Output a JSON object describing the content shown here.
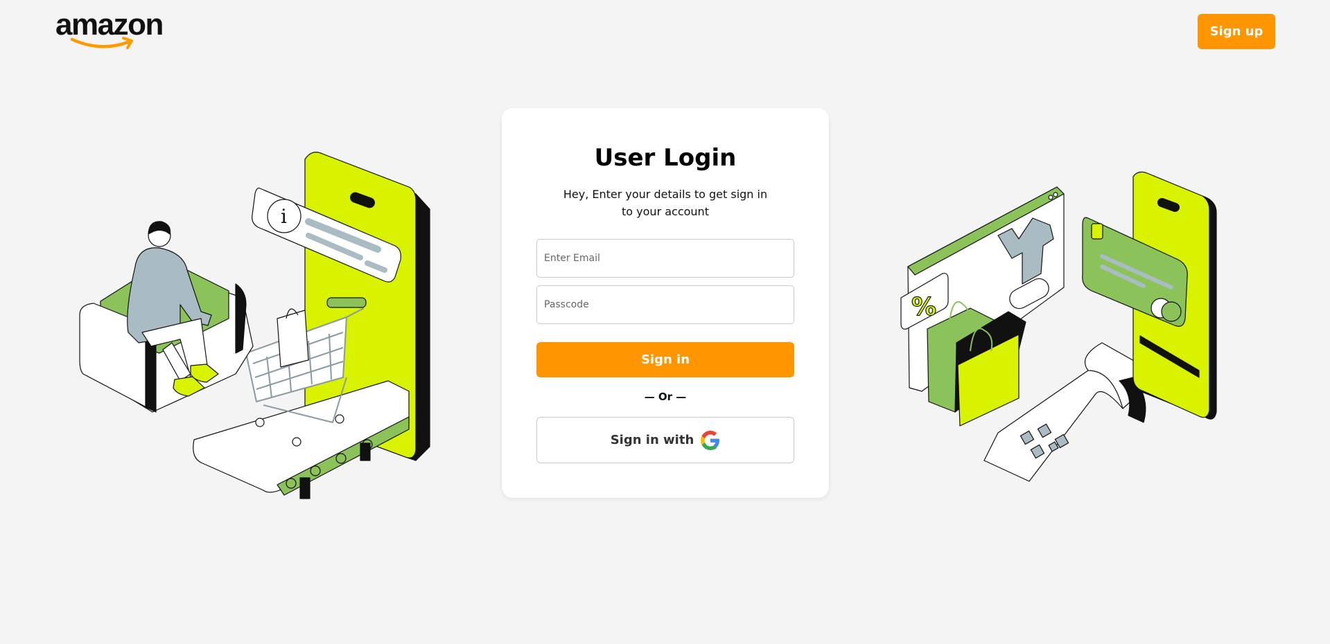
{
  "header": {
    "logo_text": "amazon",
    "signup_label": "Sign up"
  },
  "login": {
    "title": "User Login",
    "subtitle": "Hey, Enter your details to get sign in to your account",
    "email_placeholder": "Enter Email",
    "passcode_placeholder": "Passcode",
    "signin_label": "Sign in",
    "or_text": "— Or —",
    "google_label": "Sign in with"
  },
  "colors": {
    "accent": "#ff9500",
    "lime": "#d9f200",
    "green": "#8bc25a",
    "background": "#f4f4f4"
  },
  "icons": {
    "google": "google-icon",
    "illustration_left": "shopping-person-phone-illustration",
    "illustration_right": "online-payment-illustration"
  }
}
